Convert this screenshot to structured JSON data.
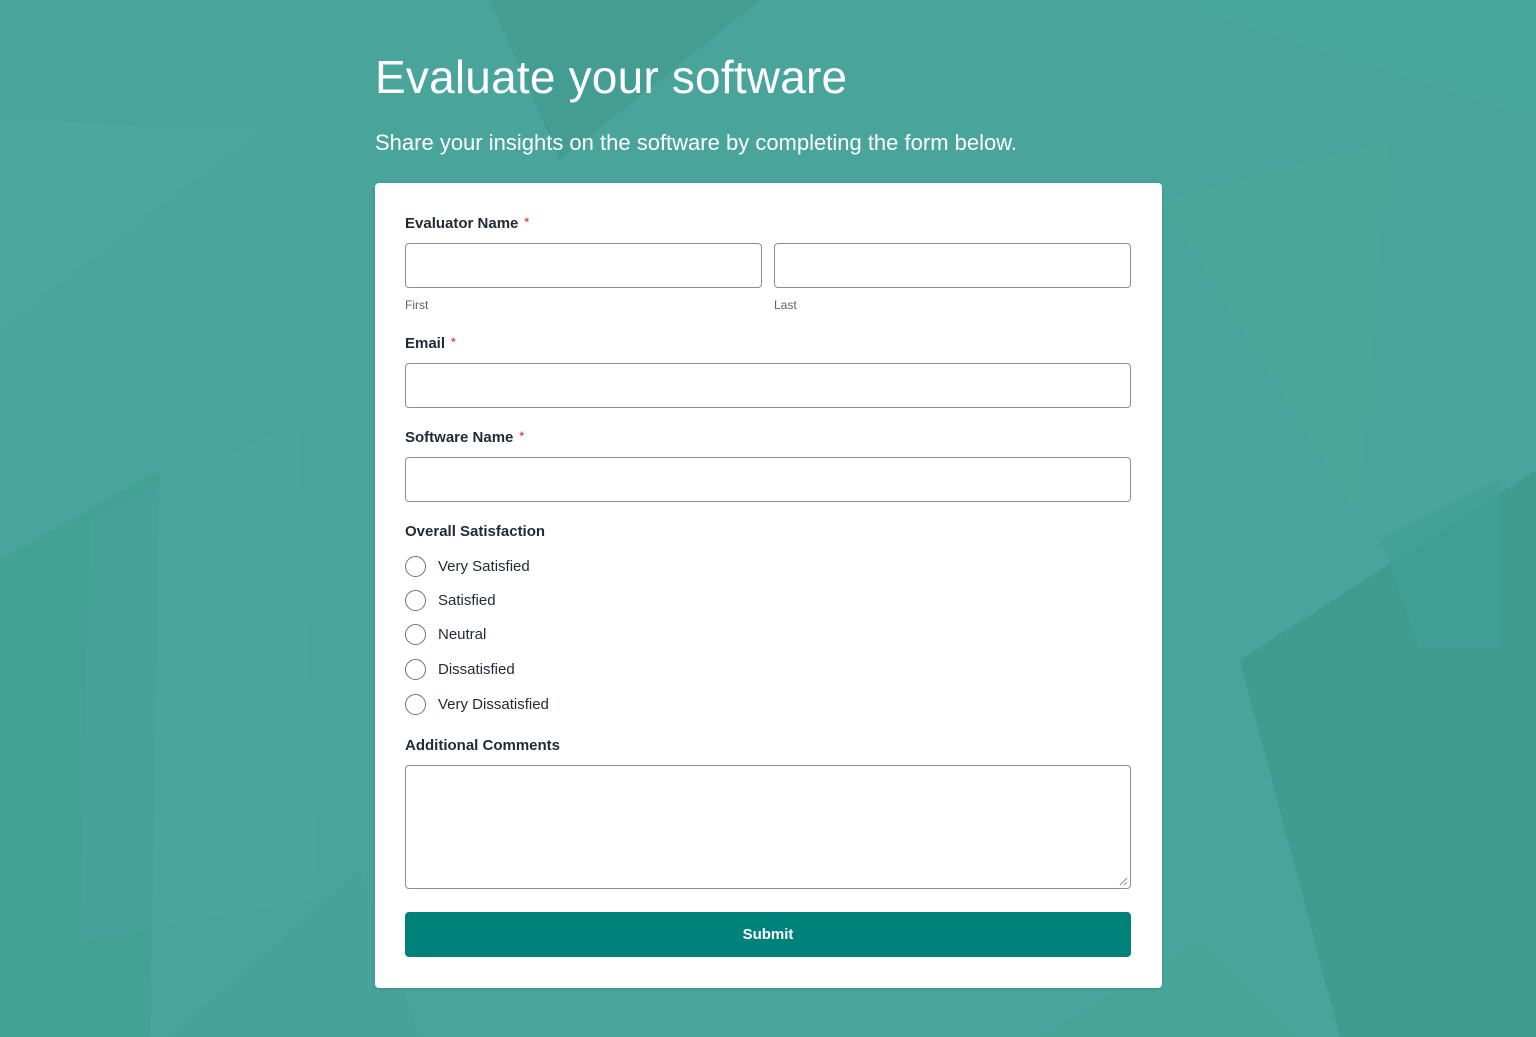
{
  "page": {
    "title": "Evaluate your software",
    "subtitle": "Share your insights on the software by completing the form below."
  },
  "form": {
    "evaluator_name": {
      "label": "Evaluator Name",
      "required_mark": "*",
      "first_sublabel": "First",
      "last_sublabel": "Last",
      "first_value": "",
      "last_value": ""
    },
    "email": {
      "label": "Email",
      "required_mark": "*",
      "value": ""
    },
    "software_name": {
      "label": "Software Name",
      "required_mark": "*",
      "value": ""
    },
    "satisfaction": {
      "label": "Overall Satisfaction",
      "options": [
        "Very Satisfied",
        "Satisfied",
        "Neutral",
        "Dissatisfied",
        "Very Dissatisfied"
      ],
      "selected": null
    },
    "comments": {
      "label": "Additional Comments",
      "value": ""
    },
    "submit_label": "Submit"
  },
  "colors": {
    "background": "#49a49b",
    "accent": "#00827a",
    "required": "#d9534f",
    "card": "#ffffff"
  },
  "icons": {
    "textarea_resize": "resize-grip-icon"
  }
}
